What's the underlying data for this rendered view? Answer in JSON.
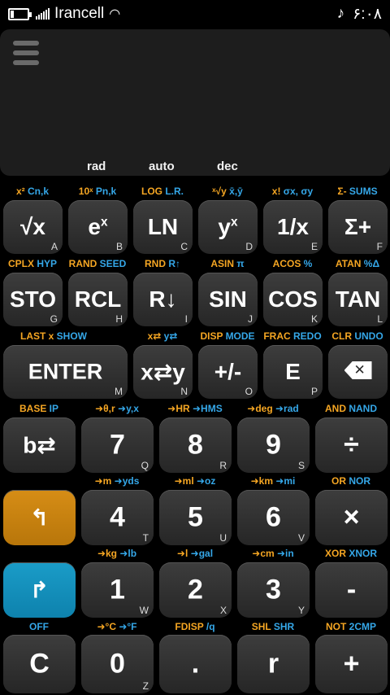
{
  "status": {
    "carrier": "Irancell",
    "time": "۶:۰۸",
    "battery_level": 0.15
  },
  "display": {
    "modes": [
      "rad",
      "auto",
      "dec"
    ]
  },
  "labels": [
    {
      "id": "l-cn",
      "parts": [
        [
          "y",
          "x² "
        ],
        [
          "b",
          "Cn,k"
        ]
      ]
    },
    {
      "id": "l-pn",
      "parts": [
        [
          "y",
          "10ˣ "
        ],
        [
          "b",
          "Pn,k"
        ]
      ]
    },
    {
      "id": "l-log",
      "parts": [
        [
          "y",
          "LOG "
        ],
        [
          "b",
          "L.R."
        ]
      ]
    },
    {
      "id": "l-xy",
      "parts": [
        [
          "y",
          "ˣ√y "
        ],
        [
          "b",
          "x̄,ȳ"
        ]
      ]
    },
    {
      "id": "l-fact",
      "parts": [
        [
          "y",
          "x! "
        ],
        [
          "b",
          "σx, σy"
        ]
      ]
    },
    {
      "id": "l-sum",
      "parts": [
        [
          "y",
          "Σ- "
        ],
        [
          "b",
          "SUMS"
        ]
      ]
    },
    {
      "id": "l-cplx",
      "parts": [
        [
          "y",
          "CPLX "
        ],
        [
          "b",
          "HYP"
        ]
      ]
    },
    {
      "id": "l-rand",
      "parts": [
        [
          "y",
          "RAND "
        ],
        [
          "b",
          "SEED"
        ]
      ]
    },
    {
      "id": "l-rnd",
      "parts": [
        [
          "y",
          "RND "
        ],
        [
          "b",
          "R↑"
        ]
      ]
    },
    {
      "id": "l-asin",
      "parts": [
        [
          "y",
          "ASIN "
        ],
        [
          "b",
          "π"
        ]
      ]
    },
    {
      "id": "l-acos",
      "parts": [
        [
          "y",
          "ACOS "
        ],
        [
          "b",
          "%"
        ]
      ]
    },
    {
      "id": "l-atan",
      "parts": [
        [
          "y",
          "ATAN "
        ],
        [
          "b",
          "%Δ"
        ]
      ]
    },
    {
      "id": "l-last",
      "parts": [
        [
          "y",
          "LAST x   "
        ],
        [
          "b",
          "SHOW"
        ]
      ]
    },
    {
      "id": "l-swap",
      "parts": [
        [
          "y",
          "x⇄ "
        ],
        [
          "b",
          "y⇄"
        ]
      ]
    },
    {
      "id": "l-disp",
      "parts": [
        [
          "y",
          "DISP "
        ],
        [
          "b",
          "MODE"
        ]
      ]
    },
    {
      "id": "l-frac",
      "parts": [
        [
          "y",
          "FRAC "
        ],
        [
          "b",
          "REDO"
        ]
      ]
    },
    {
      "id": "l-clr",
      "parts": [
        [
          "y",
          "CLR "
        ],
        [
          "b",
          "UNDO"
        ]
      ]
    },
    {
      "id": "l-base",
      "parts": [
        [
          "y",
          "BASE "
        ],
        [
          "b",
          "IP"
        ]
      ]
    },
    {
      "id": "l-polar",
      "parts": [
        [
          "y",
          "➜θ,r "
        ],
        [
          "b",
          "➜y,x"
        ]
      ]
    },
    {
      "id": "l-hr",
      "parts": [
        [
          "y",
          "➜HR "
        ],
        [
          "b",
          "➜HMS"
        ]
      ]
    },
    {
      "id": "l-deg",
      "parts": [
        [
          "y",
          "➜deg "
        ],
        [
          "b",
          "➜rad"
        ]
      ]
    },
    {
      "id": "l-and",
      "parts": [
        [
          "y",
          "AND "
        ],
        [
          "b",
          "NAND"
        ]
      ]
    },
    {
      "id": "l-m",
      "parts": [
        [
          "y",
          "➜m "
        ],
        [
          "b",
          "➜yds"
        ]
      ]
    },
    {
      "id": "l-ml",
      "parts": [
        [
          "y",
          "➜ml "
        ],
        [
          "b",
          "➜oz"
        ]
      ]
    },
    {
      "id": "l-km",
      "parts": [
        [
          "y",
          "➜km "
        ],
        [
          "b",
          "➜mi"
        ]
      ]
    },
    {
      "id": "l-or",
      "parts": [
        [
          "y",
          "OR "
        ],
        [
          "b",
          "NOR"
        ]
      ]
    },
    {
      "id": "l-kg",
      "parts": [
        [
          "y",
          "➜kg "
        ],
        [
          "b",
          "➜lb"
        ]
      ]
    },
    {
      "id": "l-l",
      "parts": [
        [
          "y",
          "➜l "
        ],
        [
          "b",
          "➜gal"
        ]
      ]
    },
    {
      "id": "l-cm",
      "parts": [
        [
          "y",
          "➜cm "
        ],
        [
          "b",
          "➜in"
        ]
      ]
    },
    {
      "id": "l-xor",
      "parts": [
        [
          "y",
          "XOR "
        ],
        [
          "b",
          "XNOR"
        ]
      ]
    },
    {
      "id": "l-off",
      "parts": [
        [
          "b",
          "OFF"
        ]
      ]
    },
    {
      "id": "l-temp",
      "parts": [
        [
          "y",
          "➜°C "
        ],
        [
          "b",
          "➜°F"
        ]
      ]
    },
    {
      "id": "l-fdisp",
      "parts": [
        [
          "y",
          "FDISP "
        ],
        [
          "b",
          "/q"
        ]
      ]
    },
    {
      "id": "l-shl",
      "parts": [
        [
          "y",
          "SHL "
        ],
        [
          "b",
          "SHR"
        ]
      ]
    },
    {
      "id": "l-not",
      "parts": [
        [
          "y",
          "NOT "
        ],
        [
          "b",
          "2CMP"
        ]
      ]
    }
  ],
  "keys": {
    "sqrt": {
      "label": "√x",
      "letter": "A"
    },
    "exp": {
      "label": "e",
      "sup": "x",
      "letter": "B"
    },
    "ln": {
      "label": "LN",
      "letter": "C"
    },
    "pow": {
      "label": "y",
      "sup": "x",
      "letter": "D"
    },
    "inv": {
      "label": "1/x",
      "letter": "E"
    },
    "sigma": {
      "label": "Σ+",
      "letter": "F"
    },
    "sto": {
      "label": "STO",
      "letter": "G"
    },
    "rcl": {
      "label": "RCL",
      "letter": "H"
    },
    "rdown": {
      "label": "R↓",
      "letter": "I"
    },
    "sin": {
      "label": "SIN",
      "letter": "J"
    },
    "cos": {
      "label": "COS",
      "letter": "K"
    },
    "tan": {
      "label": "TAN",
      "letter": "L"
    },
    "enter": {
      "label": "ENTER",
      "letter": "M"
    },
    "xy": {
      "label": "x⇄y",
      "letter": "N"
    },
    "chs": {
      "label": "+/-",
      "letter": "O"
    },
    "e": {
      "label": "E",
      "letter": "P"
    },
    "base": {
      "label": "b⇄",
      "letter": ""
    },
    "n7": {
      "label": "7",
      "letter": "Q"
    },
    "n8": {
      "label": "8",
      "letter": "R"
    },
    "n9": {
      "label": "9",
      "letter": "S"
    },
    "div": {
      "label": "÷",
      "letter": ""
    },
    "shift1": {
      "label": "↰",
      "letter": ""
    },
    "n4": {
      "label": "4",
      "letter": "T"
    },
    "n5": {
      "label": "5",
      "letter": "U"
    },
    "n6": {
      "label": "6",
      "letter": "V"
    },
    "mul": {
      "label": "×",
      "letter": ""
    },
    "shift2": {
      "label": "↱",
      "letter": ""
    },
    "n1": {
      "label": "1",
      "letter": "W"
    },
    "n2": {
      "label": "2",
      "letter": "X"
    },
    "n3": {
      "label": "3",
      "letter": "Y"
    },
    "sub": {
      "label": "-",
      "letter": ""
    },
    "clear": {
      "label": "C",
      "letter": ""
    },
    "n0": {
      "label": "0",
      "letter": "Z"
    },
    "dot": {
      "label": ".",
      "letter": ""
    },
    "r": {
      "label": "r",
      "letter": ""
    },
    "add": {
      "label": "+",
      "letter": ""
    }
  },
  "colors": {
    "shift_orange": "#d68d16",
    "shift_cyan": "#1a9cc8",
    "label_yellow": "#f5a623",
    "label_blue": "#35a7e8"
  }
}
